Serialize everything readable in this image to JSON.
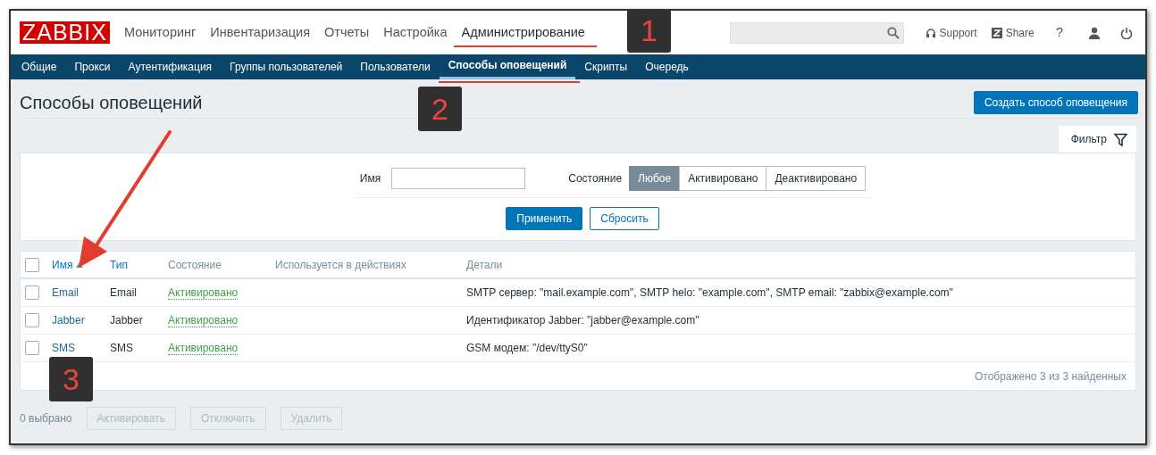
{
  "logo": "ZABBIX",
  "main_menu": [
    {
      "label": "Мониторинг",
      "selected": false
    },
    {
      "label": "Инвентаризация",
      "selected": false
    },
    {
      "label": "Отчеты",
      "selected": false
    },
    {
      "label": "Настройка",
      "selected": false
    },
    {
      "label": "Администрирование",
      "selected": true
    }
  ],
  "header_links": [
    {
      "kind": "support",
      "label": "Support"
    },
    {
      "kind": "share",
      "label": "Share"
    },
    {
      "kind": "help",
      "label": "?"
    },
    {
      "kind": "user"
    },
    {
      "kind": "power"
    }
  ],
  "sub_menu": [
    {
      "label": "Общие",
      "selected": false
    },
    {
      "label": "Прокси",
      "selected": false
    },
    {
      "label": "Аутентификация",
      "selected": false
    },
    {
      "label": "Группы пользователей",
      "selected": false
    },
    {
      "label": "Пользователи",
      "selected": false
    },
    {
      "label": "Способы оповещений",
      "selected": true
    },
    {
      "label": "Скрипты",
      "selected": false
    },
    {
      "label": "Очередь",
      "selected": false
    }
  ],
  "page_title": "Способы оповещений",
  "create_button": "Создать способ оповещения",
  "filter": {
    "tab_label": "Фильтр",
    "name_label": "Имя",
    "state_label": "Состояние",
    "state_options": [
      {
        "label": "Любое",
        "selected": true
      },
      {
        "label": "Активировано",
        "selected": false
      },
      {
        "label": "Деактивировано",
        "selected": false
      }
    ],
    "apply_button": "Применить",
    "reset_button": "Сбросить"
  },
  "table": {
    "select_all_checked": false,
    "columns": [
      {
        "label": "Имя",
        "kind": "link",
        "sorted": true
      },
      {
        "label": "Тип",
        "kind": "link",
        "sorted": false
      },
      {
        "label": "Состояние",
        "kind": "plain",
        "sorted": false
      },
      {
        "label": "Используется в действиях",
        "kind": "plain",
        "sorted": false
      },
      {
        "label": "Детали",
        "kind": "plain",
        "sorted": false
      }
    ],
    "rows": [
      {
        "checked": false,
        "name": "Email",
        "type": "Email",
        "status": "Активировано",
        "details": "SMTP сервер: \"mail.example.com\", SMTP helo: \"example.com\", SMTP email: \"zabbix@example.com\""
      },
      {
        "checked": false,
        "name": "Jabber",
        "type": "Jabber",
        "status": "Активировано",
        "details": "Идентификатор Jabber: \"jabber@example.com\""
      },
      {
        "checked": false,
        "name": "SMS",
        "type": "SMS",
        "status": "Активировано",
        "details": "GSM модем: \"/dev/ttyS0\""
      }
    ],
    "summary": "Отображено 3 из 3 найденных"
  },
  "selected_count": "0 выбрано",
  "actions": [
    {
      "label": "Активировать",
      "disabled": true
    },
    {
      "label": "Отключить",
      "disabled": true
    },
    {
      "label": "Удалить",
      "disabled": true
    }
  ],
  "annotations": [
    {
      "kind": "badge",
      "text": "1"
    },
    {
      "kind": "badge",
      "text": "2"
    },
    {
      "kind": "badge",
      "text": "3"
    },
    {
      "kind": "arrow"
    }
  ]
}
